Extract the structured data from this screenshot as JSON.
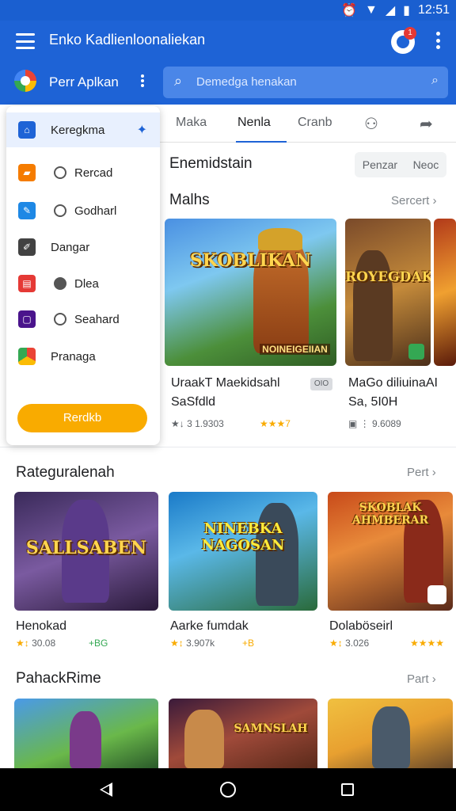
{
  "status_bar": {
    "time": "12:51"
  },
  "app_bar": {
    "title": "Enko Kadlienloonaliekan",
    "notification_count": "1",
    "store_name": "Perr Aplkan",
    "search": {
      "placeholder": "Demedga henakan"
    }
  },
  "drawer": {
    "items": [
      {
        "label": "Keregkma",
        "icon": "home-icon",
        "color": "#1e63d6",
        "active": true
      },
      {
        "label": "Rercad",
        "icon": "store-icon",
        "color": "#f57c00"
      },
      {
        "label": "Godharl",
        "icon": "tag-icon",
        "color": "#1e88e5"
      },
      {
        "label": "Dangar",
        "icon": "edit-icon",
        "color": "#424242"
      },
      {
        "label": "Dlea",
        "icon": "calendar-icon",
        "color": "#e53935"
      },
      {
        "label": "Seahard",
        "icon": "book-icon",
        "color": "#4a148c"
      },
      {
        "label": "Pranaga",
        "icon": "play-store-icon",
        "color": "#34a853"
      }
    ],
    "button_label": "Rerdkb"
  },
  "tabs": [
    {
      "label": "Maka"
    },
    {
      "label": "Nenla",
      "active": true
    },
    {
      "label": "Cranb"
    }
  ],
  "section_featured": {
    "heading": "Enemidstain",
    "chip_left": "Penzar",
    "chip_right": "Neoc",
    "subheading": "Malhs",
    "see_more": "Sercert"
  },
  "featured_cards": [
    {
      "title_line1": "UraakT Maekidsahl",
      "title_line2": "SaSfdld",
      "badge": "OIO",
      "meta": "3 1.9303",
      "stars": "★★★7",
      "art_title": "SKOBLIKAN",
      "art_sub": "NOINEIGEIIAN"
    },
    {
      "title_line1": "MaGo diliuinaAI",
      "title_line2": "Sa, 5I0H",
      "meta": "9.6089",
      "art_title": "ROYEGDAK"
    }
  ],
  "section_category": {
    "heading": "Rateguralenah",
    "see_more": "Pert"
  },
  "category_cards": [
    {
      "title": "Henokad",
      "meta": "30.08",
      "extra": "+BG",
      "art_title": "SALLSABEN"
    },
    {
      "title": "Aarke fumdak",
      "meta": "3.907k",
      "extra": "+B",
      "art_title": "NINEBKA NAGOSAN"
    },
    {
      "title": "Dolaböseirl",
      "meta": "3.026",
      "extra": "★★★★",
      "art_title": "SKOBLAK AHMBERAR"
    }
  ],
  "section_third": {
    "heading": "PahackRime",
    "see_more": "Part"
  },
  "third_cards": [
    {
      "art_title": ""
    },
    {
      "art_title": "SAMNSLAH"
    },
    {
      "art_title": ""
    }
  ]
}
